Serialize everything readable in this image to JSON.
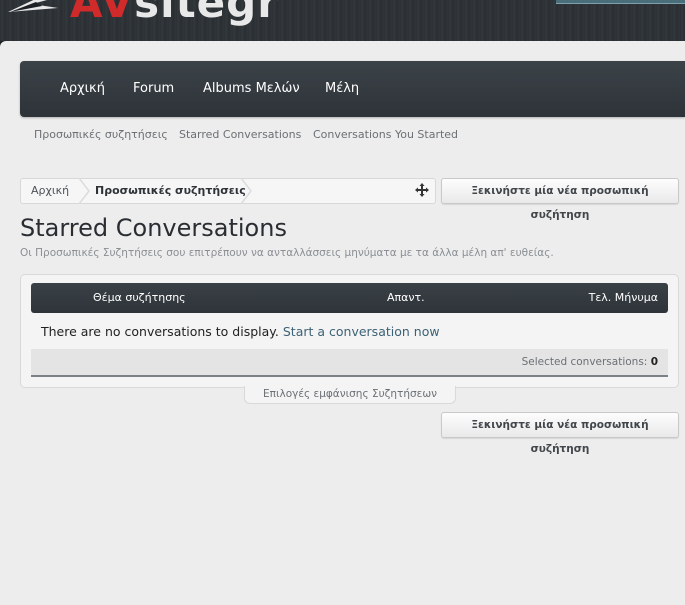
{
  "header": {
    "logo_prefix": "AV",
    "logo_suffix": "sitegr"
  },
  "navbar": {
    "tabs": [
      "Αρχική",
      "Forum",
      "Albums Μελών",
      "Μέλη"
    ]
  },
  "subnav": {
    "items": [
      "Προσωπικές συζητήσεις",
      "Starred Conversations",
      "Conversations You Started"
    ]
  },
  "breadcrumb": {
    "items": [
      "Αρχική",
      "Προσωπικές συζητήσεις"
    ],
    "jump_icon": "move-icon"
  },
  "buttons": {
    "new_conversation": "Ξεκινήστε μία νέα προσωπική συζήτηση"
  },
  "main": {
    "title": "Starred Conversations",
    "description": "Οι Προσωπικές Συζητήσεις σου επιτρέπουν να ανταλλάσσεις μηνύματα με τα άλλα μέλη απ' ευθείας."
  },
  "table": {
    "columns": [
      "Θέμα συζήτησης",
      "Απαντ.",
      "Τελ. Μήνυμα"
    ],
    "empty_text": "There are no conversations to display.",
    "empty_link": "Start a conversation now",
    "selected_label": "Selected conversations:",
    "selected_count": "0"
  },
  "options_tab": "Επιλογές εμφάνισης Συζητήσεων",
  "colors": {
    "accent_red": "#d12a2a",
    "nav_dark": "#2d3338",
    "link": "#3c6275"
  }
}
